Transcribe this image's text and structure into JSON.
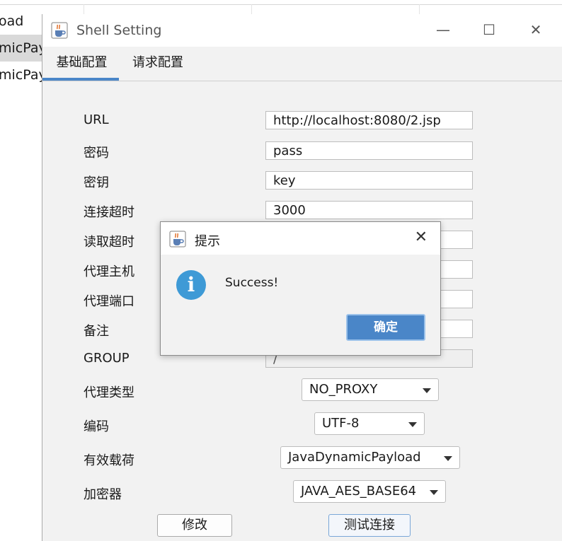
{
  "background_table": {
    "rows": [
      "oad",
      "micPayl",
      "micPayl"
    ],
    "selected_row_index": 1
  },
  "window": {
    "title": "Shell Setting",
    "controls": {
      "minimize": "—",
      "maximize": "☐",
      "close": "✕"
    },
    "tabs": [
      {
        "label": "基础配置",
        "active": true
      },
      {
        "label": "请求配置",
        "active": false
      }
    ]
  },
  "form": {
    "url_label": "URL",
    "url_value": "http://localhost:8080/2.jsp",
    "password_label": "密码",
    "password_value": "pass",
    "key_label": "密钥",
    "key_value": "key",
    "connect_timeout_label": "连接超时",
    "connect_timeout_value": "3000",
    "read_timeout_label": "读取超时",
    "proxy_host_label": "代理主机",
    "proxy_port_label": "代理端口",
    "remark_label": "备注",
    "group_label": "GROUP",
    "group_value": "/",
    "proxy_type_label": "代理类型",
    "proxy_type_value": "NO_PROXY",
    "encoding_label": "编码",
    "encoding_value": "UTF-8",
    "payload_label": "有效载荷",
    "payload_value": "JavaDynamicPayload",
    "cryption_label": "加密器",
    "cryption_value": "JAVA_AES_BASE64"
  },
  "buttons": {
    "modify": "修改",
    "test_connection": "测试连接"
  },
  "dialog": {
    "title": "提示",
    "message": "Success!",
    "ok": "确定",
    "close": "✕",
    "info_glyph": "i"
  },
  "colors": {
    "accent": "#4a86c8",
    "info_icon": "#3e9ad6",
    "panel_bg": "#f2f2f2"
  },
  "icons": {
    "app_icon": "java-cup-icon",
    "dialog_icon": "java-cup-icon",
    "message_icon": "info-icon"
  }
}
